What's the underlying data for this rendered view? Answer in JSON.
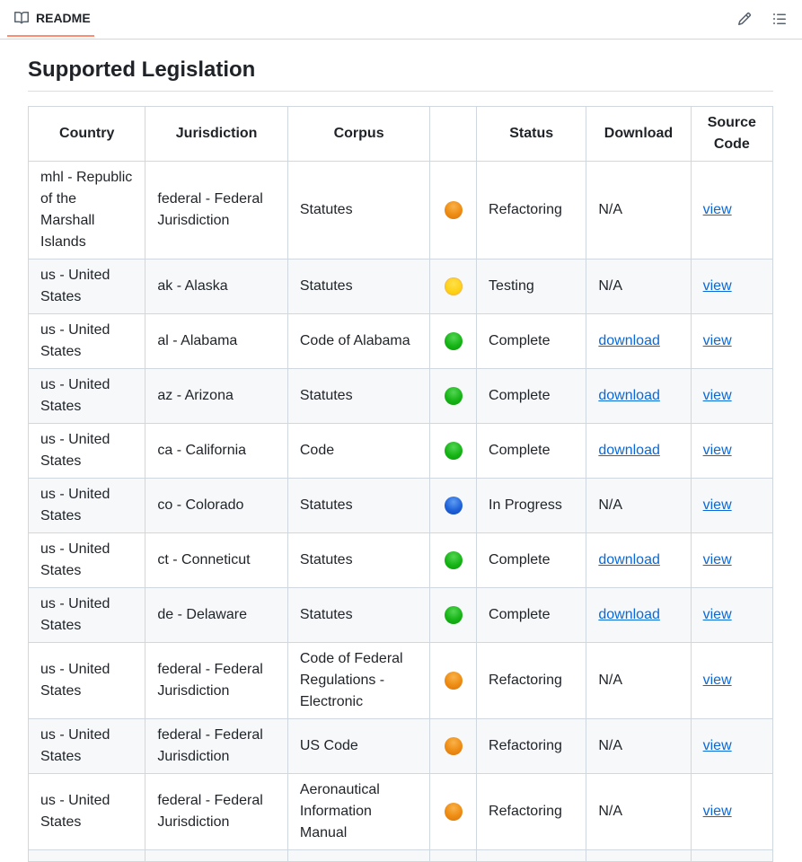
{
  "header": {
    "tab_label": "README",
    "tab_icon": "book-icon",
    "edit_icon": "pencil-icon",
    "toc_icon": "list-icon"
  },
  "heading": "Supported Legislation",
  "table": {
    "headers": [
      "Country",
      "Jurisdiction",
      "Corpus",
      "",
      "Status",
      "Download",
      "Source Code"
    ],
    "status_colors": {
      "Refactoring": "#ef8f16",
      "Testing": "#fdd011",
      "Complete": "#16b416",
      "In Progress": "#1f62d9"
    },
    "rows": [
      {
        "country": "mhl - Republic of the Marshall Islands",
        "jurisdiction": "federal - Federal Jurisdiction",
        "corpus": "Statutes",
        "indicator": "orange",
        "status": "Refactoring",
        "download": "N/A",
        "source": "view"
      },
      {
        "country": "us - United States",
        "jurisdiction": "ak - Alaska",
        "corpus": "Statutes",
        "indicator": "yellow",
        "status": "Testing",
        "download": "N/A",
        "source": "view"
      },
      {
        "country": "us - United States",
        "jurisdiction": "al - Alabama",
        "corpus": "Code of Alabama",
        "indicator": "green",
        "status": "Complete",
        "download": "download",
        "source": "view"
      },
      {
        "country": "us - United States",
        "jurisdiction": "az - Arizona",
        "corpus": "Statutes",
        "indicator": "green",
        "status": "Complete",
        "download": "download",
        "source": "view"
      },
      {
        "country": "us - United States",
        "jurisdiction": "ca - California",
        "corpus": "Code",
        "indicator": "green",
        "status": "Complete",
        "download": "download",
        "source": "view"
      },
      {
        "country": "us - United States",
        "jurisdiction": "co - Colorado",
        "corpus": "Statutes",
        "indicator": "blue",
        "status": "In Progress",
        "download": "N/A",
        "source": "view"
      },
      {
        "country": "us - United States",
        "jurisdiction": "ct - Conneticut",
        "corpus": "Statutes",
        "indicator": "green",
        "status": "Complete",
        "download": "download",
        "source": "view"
      },
      {
        "country": "us - United States",
        "jurisdiction": "de - Delaware",
        "corpus": "Statutes",
        "indicator": "green",
        "status": "Complete",
        "download": "download",
        "source": "view"
      },
      {
        "country": "us - United States",
        "jurisdiction": "federal - Federal Jurisdiction",
        "corpus": "Code of Federal Regulations - Electronic",
        "indicator": "orange",
        "status": "Refactoring",
        "download": "N/A",
        "source": "view"
      },
      {
        "country": "us - United States",
        "jurisdiction": "federal - Federal Jurisdiction",
        "corpus": "US Code",
        "indicator": "orange",
        "status": "Refactoring",
        "download": "N/A",
        "source": "view"
      },
      {
        "country": "us - United States",
        "jurisdiction": "federal - Federal Jurisdiction",
        "corpus": "Aeronautical Information Manual",
        "indicator": "orange",
        "status": "Refactoring",
        "download": "N/A",
        "source": "view"
      },
      {
        "country": "",
        "jurisdiction": "",
        "corpus": "",
        "indicator": "",
        "status": "",
        "download": "",
        "source": ""
      }
    ]
  }
}
